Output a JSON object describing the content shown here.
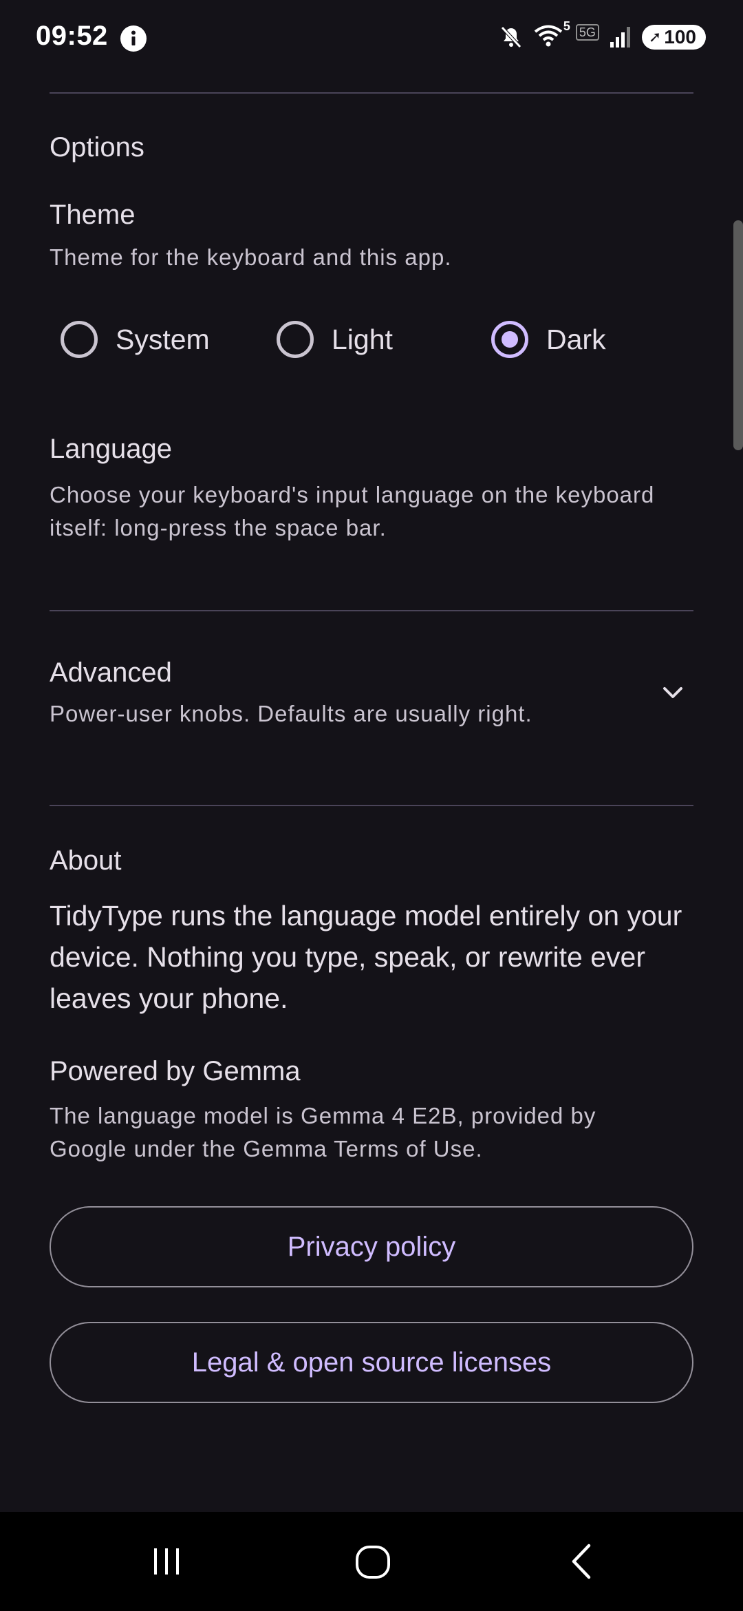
{
  "status_bar": {
    "time": "09:52",
    "battery": "100",
    "icons": [
      "info-icon",
      "mute-icon",
      "wifi-icon",
      "5g-icon",
      "signal-icon",
      "battery-icon"
    ],
    "wifi_badge": "5",
    "network": "5G"
  },
  "options": {
    "section_title": "Options",
    "theme": {
      "title": "Theme",
      "description": "Theme for the keyboard and this app.",
      "choices": [
        "System",
        "Light",
        "Dark"
      ],
      "selected": "Dark"
    },
    "language": {
      "title": "Language",
      "description": "Choose your keyboard's input language on the keyboard itself: long-press the space bar."
    }
  },
  "advanced": {
    "title": "Advanced",
    "description": "Power-user knobs. Defaults are usually right."
  },
  "about": {
    "section_title": "About",
    "text": "TidyType runs the language model entirely on your device. Nothing you type, speak, or rewrite ever leaves your phone.",
    "powered_title": "Powered by Gemma",
    "powered_text": "The language model is Gemma 4 E2B, provided by Google under the Gemma Terms of Use.",
    "privacy_button": "Privacy policy",
    "legal_button": "Legal & open source licenses"
  },
  "nav_bar": {
    "icons": [
      "recents-icon",
      "home-icon",
      "back-icon"
    ]
  },
  "colors": {
    "background": "#141218",
    "accent": "#d0bcff",
    "divider": "#4a4458",
    "text_primary": "#e6e0e9",
    "text_secondary": "#cac4d0"
  }
}
